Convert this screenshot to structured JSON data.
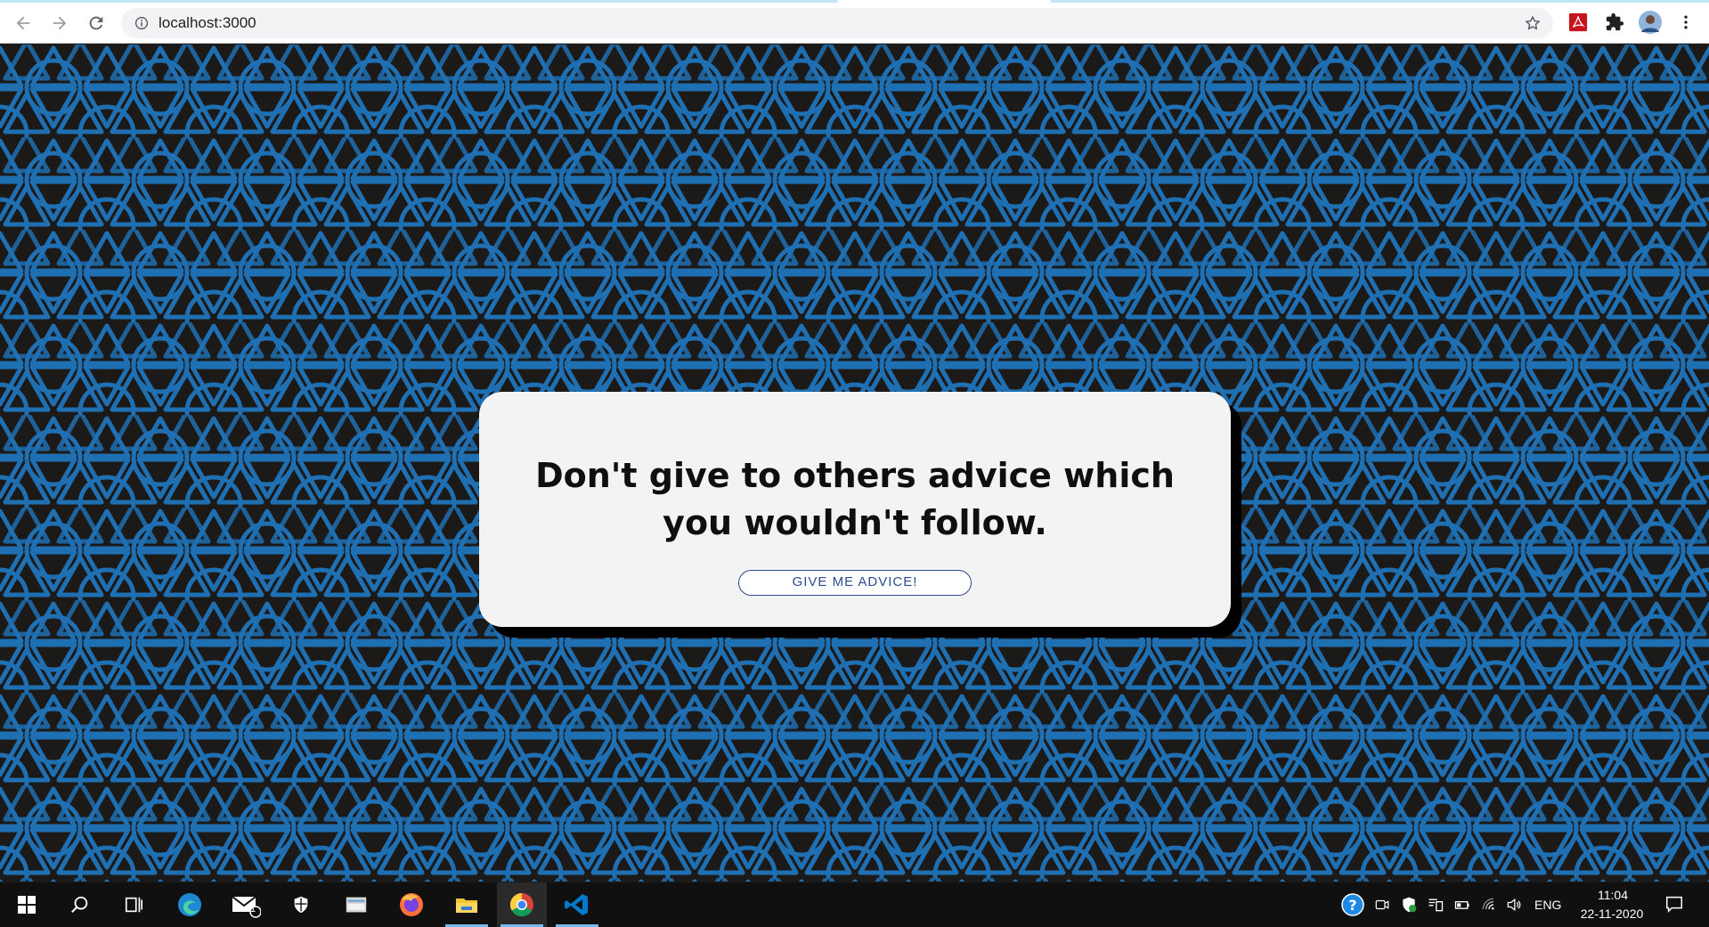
{
  "browser": {
    "url": "localhost:3000",
    "icons": [
      "back-arrow-icon",
      "forward-arrow-icon",
      "reload-icon",
      "site-info-icon",
      "bookmark-star-icon",
      "acrobat-extension-icon",
      "extensions-puzzle-icon",
      "profile-avatar-icon",
      "menu-kebab-icon"
    ]
  },
  "card": {
    "advice_text": "Don't give to others advice which you wouldn't follow.",
    "button_label": "GIVE ME ADVICE!"
  },
  "colors": {
    "background": "#1c1a19",
    "pattern": "#1f6fb3",
    "card": "#f3f3f3",
    "button_text": "#2d4c8f",
    "taskbar": "#101010"
  },
  "taskbar": {
    "apps": [
      "windows-start-icon",
      "search-icon",
      "task-view-icon",
      "edge-icon",
      "mail-icon",
      "windows-security-icon",
      "file-manager-icon",
      "firefox-icon",
      "file-explorer-icon",
      "chrome-icon",
      "vscode-icon"
    ],
    "mail_badge": "1",
    "language": "ENG",
    "time": "11:04",
    "date": "22-11-2020"
  }
}
